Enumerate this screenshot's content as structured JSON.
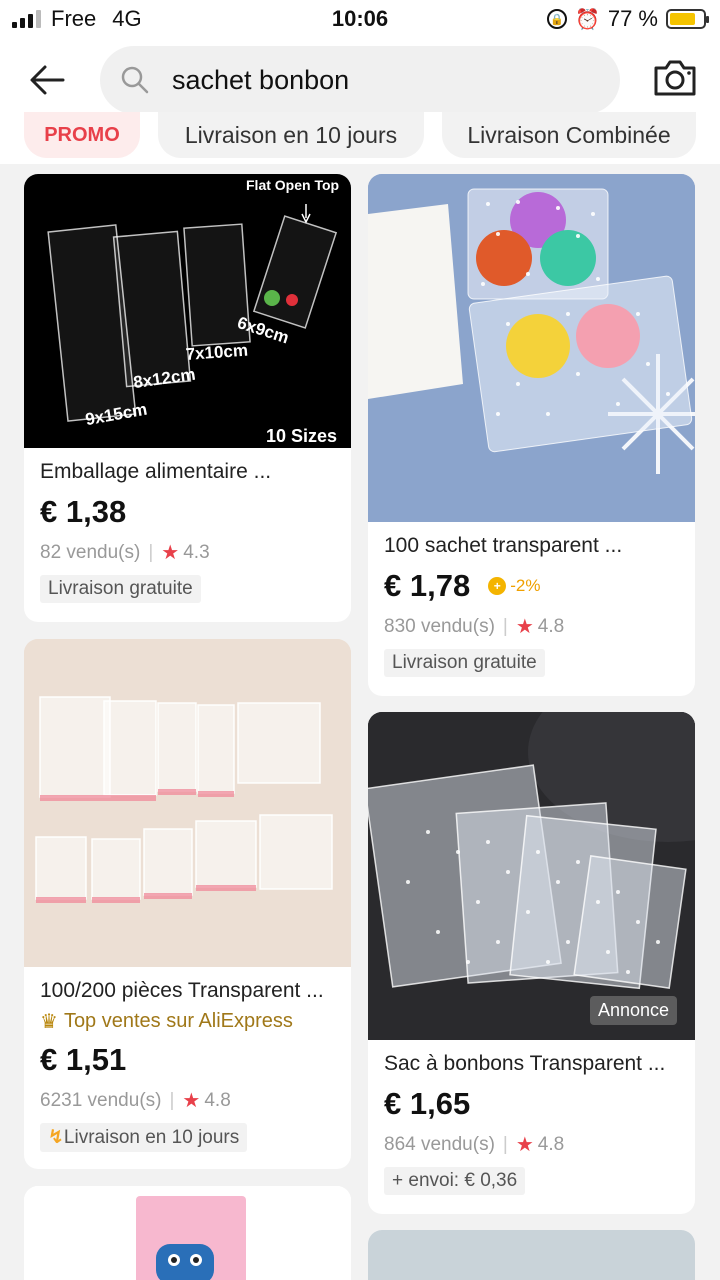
{
  "status_bar": {
    "carrier": "Free",
    "network": "4G",
    "time": "10:06",
    "battery": "77 %",
    "battery_level": 0.77
  },
  "header": {
    "search_query": "sachet bonbon",
    "icons": {
      "back": "back-arrow-icon",
      "search": "search-icon",
      "camera": "camera-icon"
    }
  },
  "filters": [
    {
      "label": "PROMO"
    },
    {
      "label": "Livraison en 10 jours"
    },
    {
      "label": "Livraison Combinée"
    }
  ],
  "products": [
    {
      "title": "Emballage alimentaire ...",
      "price": "€ 1,38",
      "sold": "82 vendu(s)",
      "rating": "4.3",
      "tag": "Livraison gratuite",
      "image_text": {
        "top": "Flat Open Top",
        "sizes": "10 Sizes",
        "s1": "6x9cm",
        "s2": "7x10cm",
        "s3": "8x12cm",
        "s4": "9x15cm"
      }
    },
    {
      "title": "100 sachet transparent ...",
      "price": "€ 1,78",
      "coin": "-2%",
      "sold": "830 vendu(s)",
      "rating": "4.8",
      "tag": "Livraison gratuite"
    },
    {
      "title": "100/200 pièces Transparent ...",
      "badge": "Top ventes sur AliExpress",
      "price": "€ 1,51",
      "sold": "6231 vendu(s)",
      "rating": "4.8",
      "tag": "Livraison en 10 jours"
    },
    {
      "title": "Sac à bonbons Transparent ...",
      "ad_label": "Annonce",
      "price": "€ 1,65",
      "sold": "864 vendu(s)",
      "rating": "4.8",
      "tag": "+ envoi: € 0,36"
    }
  ],
  "colors": {
    "accent_red": "#e8404a",
    "coin_gold": "#f4b400",
    "top_sales_gold": "#a07819"
  }
}
